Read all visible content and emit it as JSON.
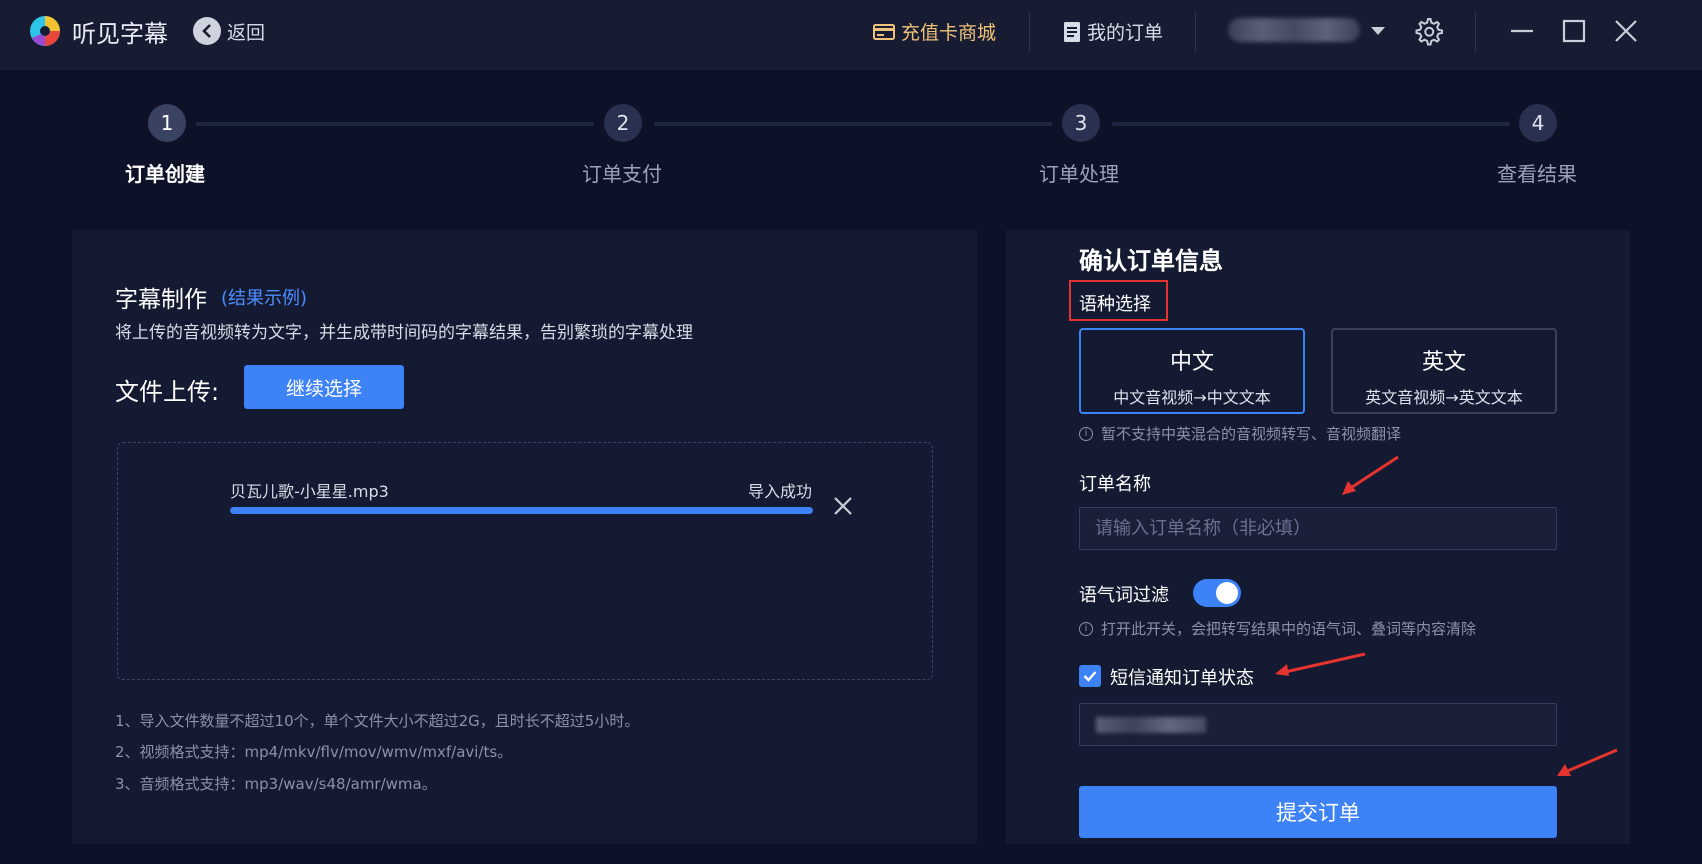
{
  "app": {
    "title": "听见字幕",
    "back_label": "返回"
  },
  "header": {
    "recharge_label": "充值卡商城",
    "orders_label": "我的订单"
  },
  "steps": [
    {
      "number": "1",
      "label": "订单创建",
      "active": true
    },
    {
      "number": "2",
      "label": "订单支付",
      "active": false
    },
    {
      "number": "3",
      "label": "订单处理",
      "active": false
    },
    {
      "number": "4",
      "label": "查看结果",
      "active": false
    }
  ],
  "left": {
    "title": "字幕制作",
    "example_link": "(结果示例)",
    "description": "将上传的音视频转为文字，并生成带时间码的字幕结果，告别繁琐的字幕处理",
    "upload_label": "文件上传:",
    "continue_button": "继续选择",
    "file": {
      "name": "贝瓦儿歌-小星星.mp3",
      "status": "导入成功",
      "progress": 1.0
    },
    "notes": [
      "1、导入文件数量不超过10个，单个文件大小不超过2G，且时长不超过5小时。",
      "2、视频格式支持：mp4/mkv/flv/mov/wmv/mxf/avi/ts。",
      "3、音频格式支持：mp3/wav/s48/amr/wma。"
    ]
  },
  "right": {
    "title": "确认订单信息",
    "language_label": "语种选择",
    "languages": [
      {
        "name": "中文",
        "desc": "中文音视频→中文文本",
        "selected": true
      },
      {
        "name": "英文",
        "desc": "英文音视频→英文文本",
        "selected": false
      }
    ],
    "language_hint": "暂不支持中英混合的音视频转写、音视频翻译",
    "order_name_label": "订单名称",
    "order_name_placeholder": "请输入订单名称（非必填）",
    "filter_label": "语气词过滤",
    "filter_on": true,
    "filter_hint": "打开此开关，会把转写结果中的语气词、叠词等内容清除",
    "sms_label": "短信通知订单状态",
    "sms_checked": true,
    "submit_button": "提交订单"
  },
  "colors": {
    "accent": "#3e82f7",
    "annotation_red": "#e5332f",
    "recharge": "#efc27a"
  }
}
